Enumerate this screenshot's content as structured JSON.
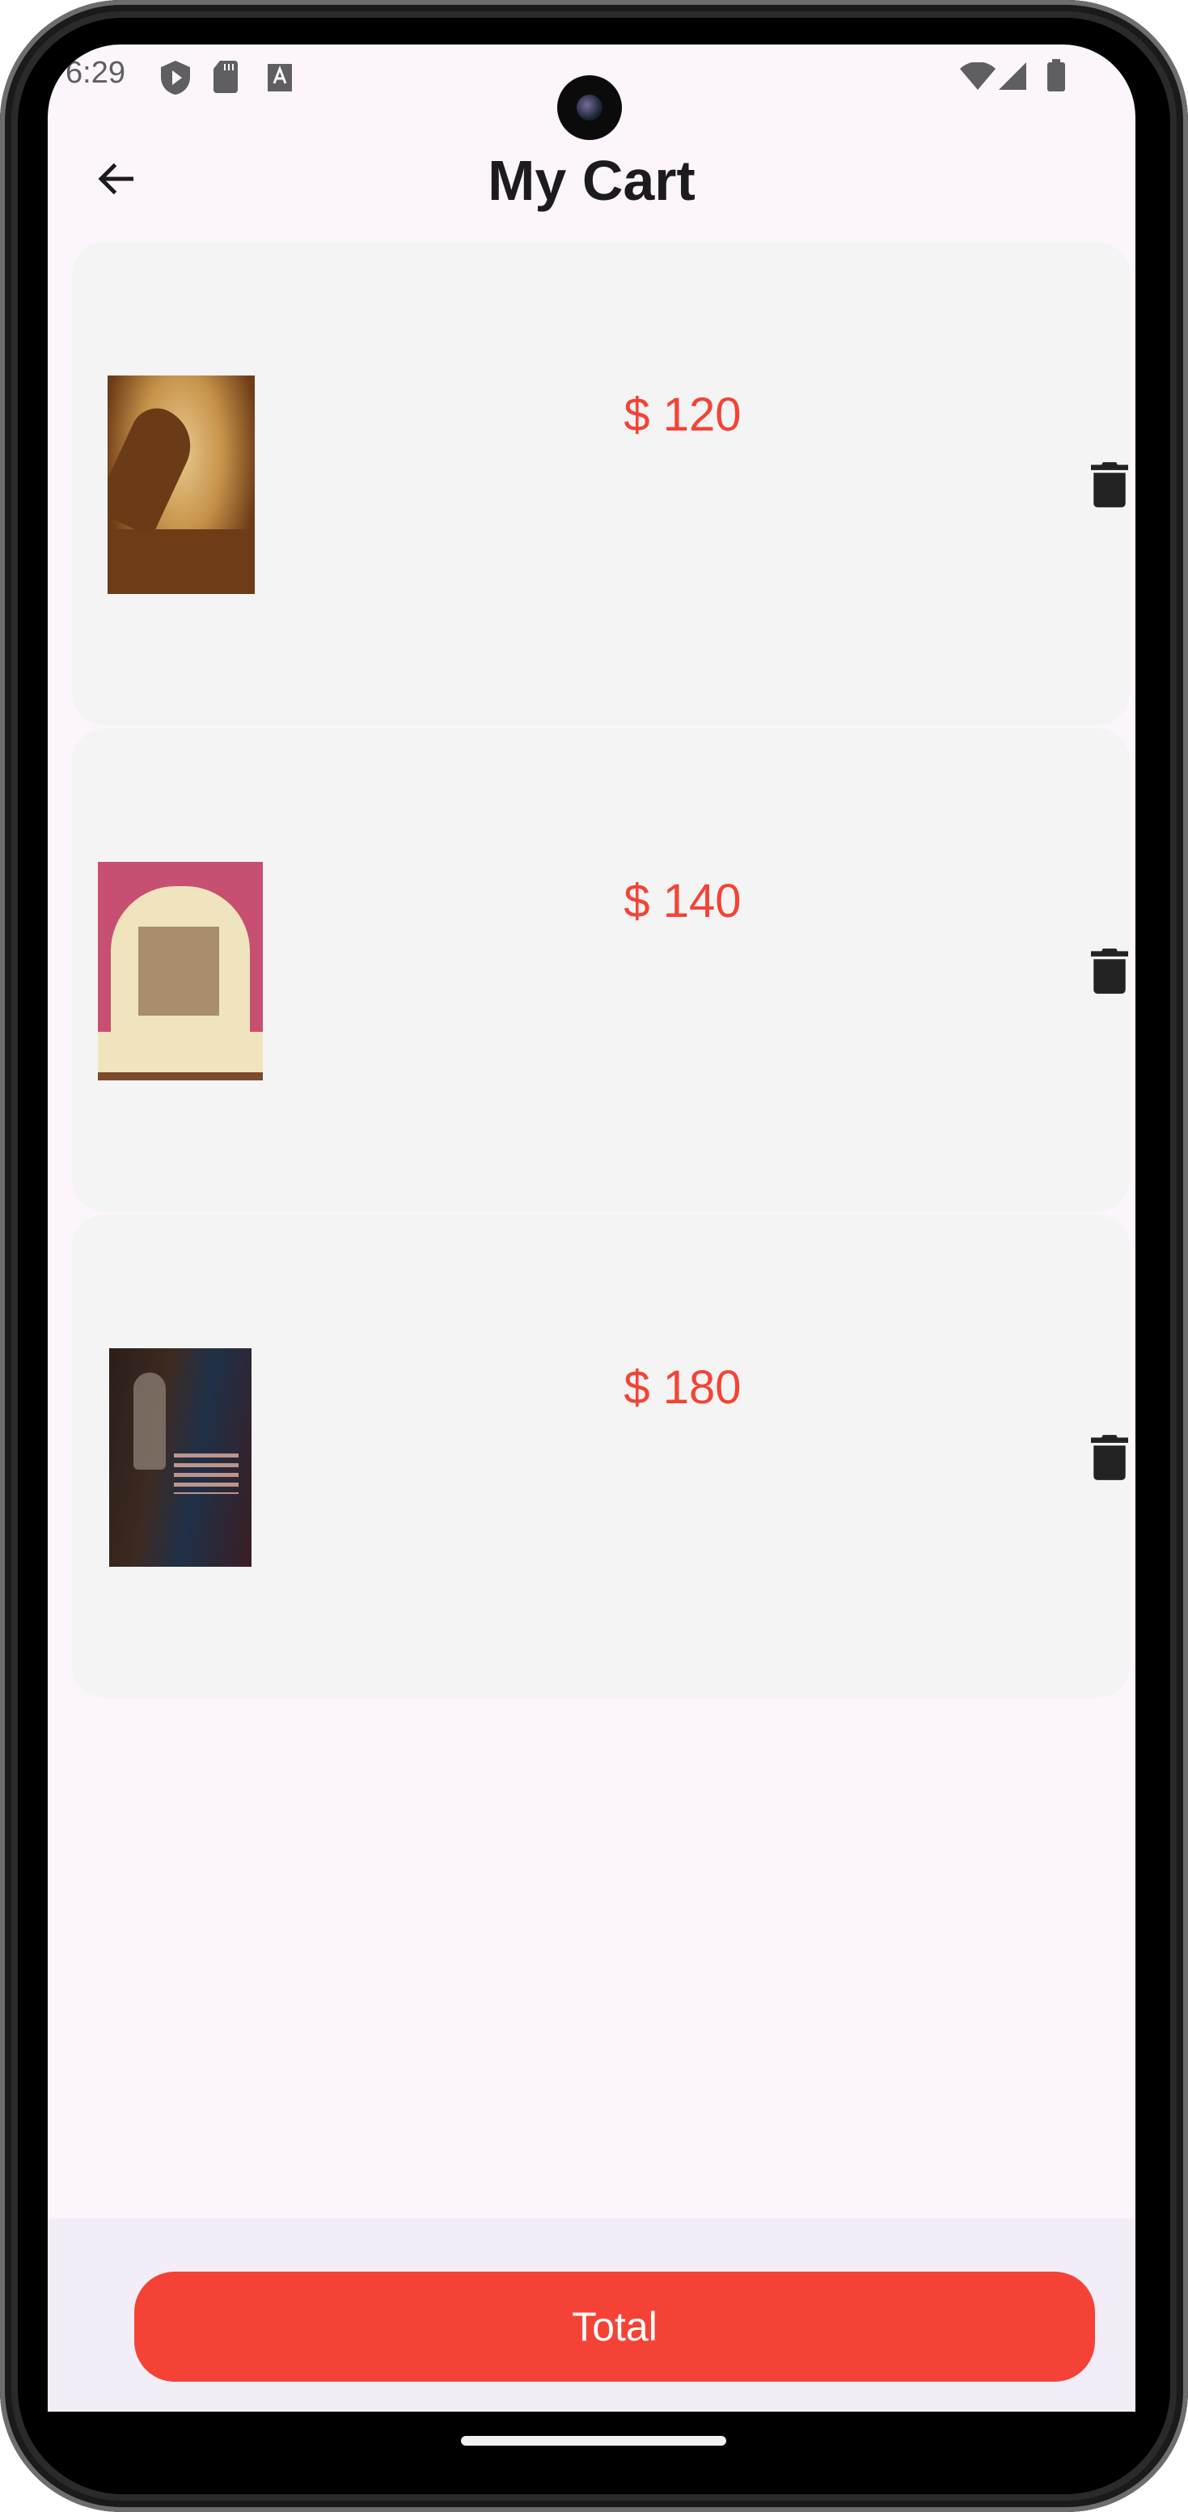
{
  "status_bar": {
    "time": "6:29"
  },
  "header": {
    "title": "My Cart",
    "back_icon": "arrow-left-icon"
  },
  "cart": {
    "items": [
      {
        "price": "$ 120",
        "delete_icon": "trash-icon"
      },
      {
        "price": "$ 140",
        "delete_icon": "trash-icon"
      },
      {
        "price": "$ 180",
        "delete_icon": "trash-icon"
      }
    ]
  },
  "footer": {
    "total_label": "Total"
  },
  "colors": {
    "accent": "#f44336",
    "card": "#f4f4f4",
    "background": "#fcf6fc",
    "bottom_bar": "#f3edf7"
  }
}
